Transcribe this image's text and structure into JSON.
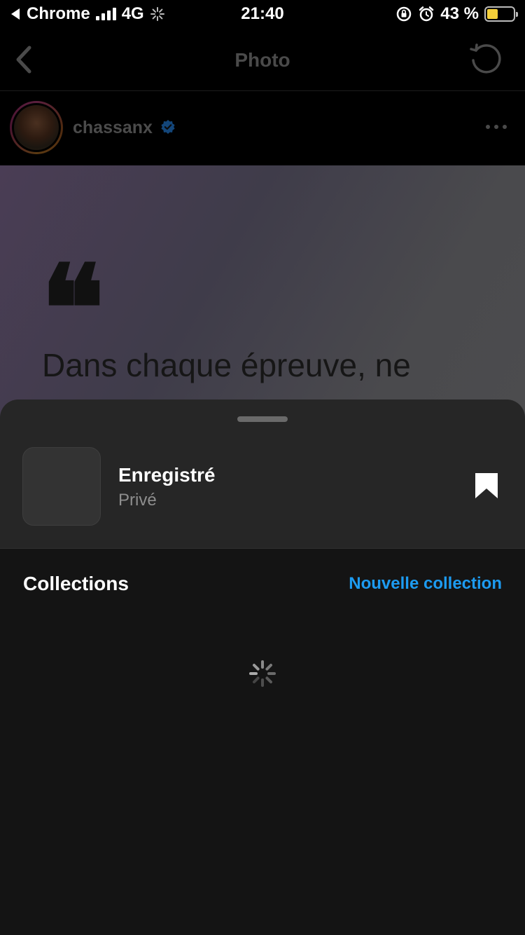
{
  "status_bar": {
    "back_app": "Chrome",
    "network": "4G",
    "time": "21:40",
    "battery_percent": "43 %",
    "battery_level": 0.43
  },
  "navbar": {
    "title": "Photo",
    "back_icon": "chevron-left-icon",
    "refresh_icon": "refresh-icon"
  },
  "post": {
    "username": "chassanx",
    "verified": true,
    "quote_mark": "❝",
    "quote_line1": "Dans chaque épreuve, ne"
  },
  "sheet": {
    "saved_title": "Enregistré",
    "saved_subtitle": "Privé",
    "bookmark_icon": "bookmark-filled-icon"
  },
  "collections": {
    "title": "Collections",
    "new_label": "Nouvelle collection",
    "loading": true
  },
  "colors": {
    "accent": "#1d9bf0",
    "sheet_bg": "#262626",
    "list_bg": "#141414",
    "battery_fill": "#f5d03a"
  }
}
